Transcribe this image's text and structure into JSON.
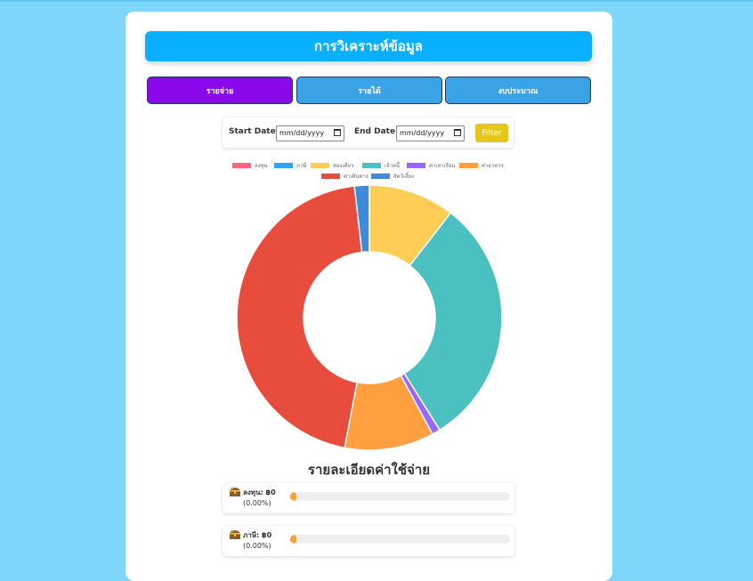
{
  "page": {
    "title": "การวิเคราะห์ข้อมูล"
  },
  "tabs": [
    {
      "label": "รายจ่าย",
      "active": true
    },
    {
      "label": "รายได้",
      "active": false
    },
    {
      "label": "งบประมาณ",
      "active": false
    }
  ],
  "filter": {
    "start_label": "Start Date:",
    "start_value": "mm/dd/yyyy",
    "end_label": "End Date:",
    "end_value": "mm/dd/yyyy",
    "button_label": "Filter"
  },
  "chart_data": {
    "type": "pie",
    "donut": true,
    "legend_position": "top",
    "categories": [
      "ลงทุน",
      "ภาษี",
      "ท่องเที่ยว",
      "เจ้าหนี้",
      "ค่าเล่าเรียน",
      "ค่าอาหาร",
      "ค่าเดินทาง",
      "สัตว์เลี้ยง"
    ],
    "values": [
      0,
      0,
      10.5,
      30.6,
      1.0,
      10.9,
      45.2,
      1.8
    ],
    "colors": [
      "#ff6384",
      "#36a2eb",
      "#ffcd56",
      "#4bc0c0",
      "#9966ff",
      "#ff9f40",
      "#e74c3c",
      "#3d8bd9"
    ]
  },
  "details": {
    "title": "รายละเอียดค่าใช้จ่าย",
    "items": [
      {
        "name": "ลงทุน: ฿0",
        "percent": "(0.00%)",
        "fill": 0
      },
      {
        "name": "ภาษี: ฿0",
        "percent": "(0.00%)",
        "fill": 0
      }
    ]
  }
}
